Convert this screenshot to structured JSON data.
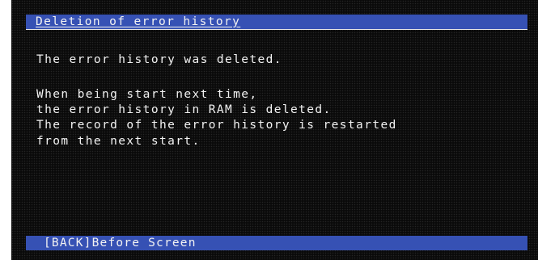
{
  "screen": {
    "title": "Deletion of error history",
    "lines": [
      "The error history was deleted.",
      "When being start next time,",
      "the error history in RAM is deleted.",
      "The record of the error history is restarted",
      "from the next start."
    ],
    "footer": {
      "back_label": "[BACK]Before Screen"
    }
  },
  "colors": {
    "background": "#0a0a0a",
    "bar": "#3651b4",
    "text": "#f2f2f2"
  }
}
